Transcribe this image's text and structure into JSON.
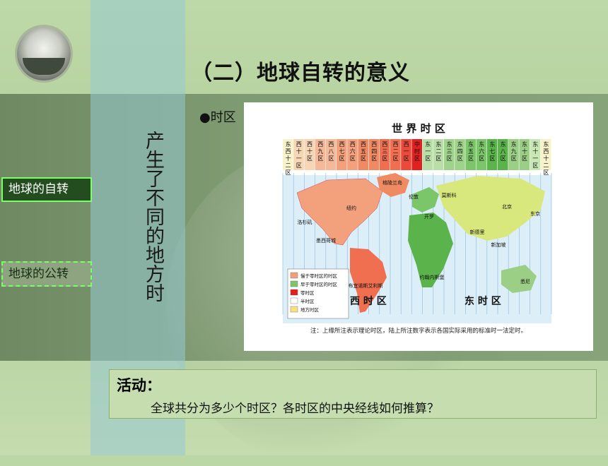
{
  "slide": {
    "title": "（二）地球自转的意义",
    "vertical_text": "产生了不同的地方时",
    "bullet": "●时区"
  },
  "nav": {
    "item1": "地球的自转",
    "item2": "地球的公转"
  },
  "map": {
    "heading": "世 界 时 区",
    "zones": [
      "东西十二区",
      "西十一区",
      "西十区",
      "西九区",
      "西八区",
      "西七区",
      "西六区",
      "西五区",
      "西四区",
      "西三区",
      "西二区",
      "西一区",
      "中时区",
      "东一区",
      "东二区",
      "东三区",
      "东四区",
      "东五区",
      "东六区",
      "东七区",
      "东八区",
      "东九区",
      "东十区",
      "东十一区",
      "东西十二区"
    ],
    "zone_labels": [
      "东西十二区",
      "西十一区",
      "西十区",
      "西九区",
      "西八区",
      "西七区",
      "西六区",
      "西五区",
      "西四区",
      "西三区",
      "西二区",
      "西一区",
      "中时区",
      "东一区",
      "东二区",
      "东三区",
      "东四区",
      "东五区",
      "东六区",
      "东七区",
      "东八区",
      "东九区",
      "东十区",
      "东十一区",
      "东西十二区"
    ],
    "zone_colors": [
      "#f7f2c9",
      "#f7d6b6",
      "#f7d6b6",
      "#f5b898",
      "#f5b898",
      "#f3a07c",
      "#f3a07c",
      "#f08a63",
      "#f08a63",
      "#ef6f50",
      "#ef6f50",
      "#ea4a3a",
      "#e12020",
      "#b9dea8",
      "#b9dea8",
      "#9fd28a",
      "#9fd28a",
      "#7cc66a",
      "#7cc66a",
      "#5ab44b",
      "#5ab44b",
      "#9bcf86",
      "#9bcf86",
      "#c9e6b5",
      "#f7f2c9"
    ],
    "places": [
      "格陵兰岛",
      "莫斯科",
      "伦敦",
      "开罗",
      "北京",
      "东京",
      "洛杉矶",
      "纽约",
      "墨西哥城",
      "新德里",
      "新加坡",
      "布宜诺斯艾利斯",
      "约翰内斯堡",
      "悉尼"
    ],
    "west_label": "西 时 区",
    "east_label": "东 时 区",
    "legend": [
      "慢于零时区的时区",
      "早于零时区的时区",
      "零时区",
      "半时区",
      "地方时区"
    ],
    "note": "注：上缘所注表示理论时区，陆上所注数字表示各国实际采用的标准时一法定时。"
  },
  "activity": {
    "title": "活动：",
    "question": "全球共分为多少个时区？各时区的中央经线如何推算？"
  }
}
